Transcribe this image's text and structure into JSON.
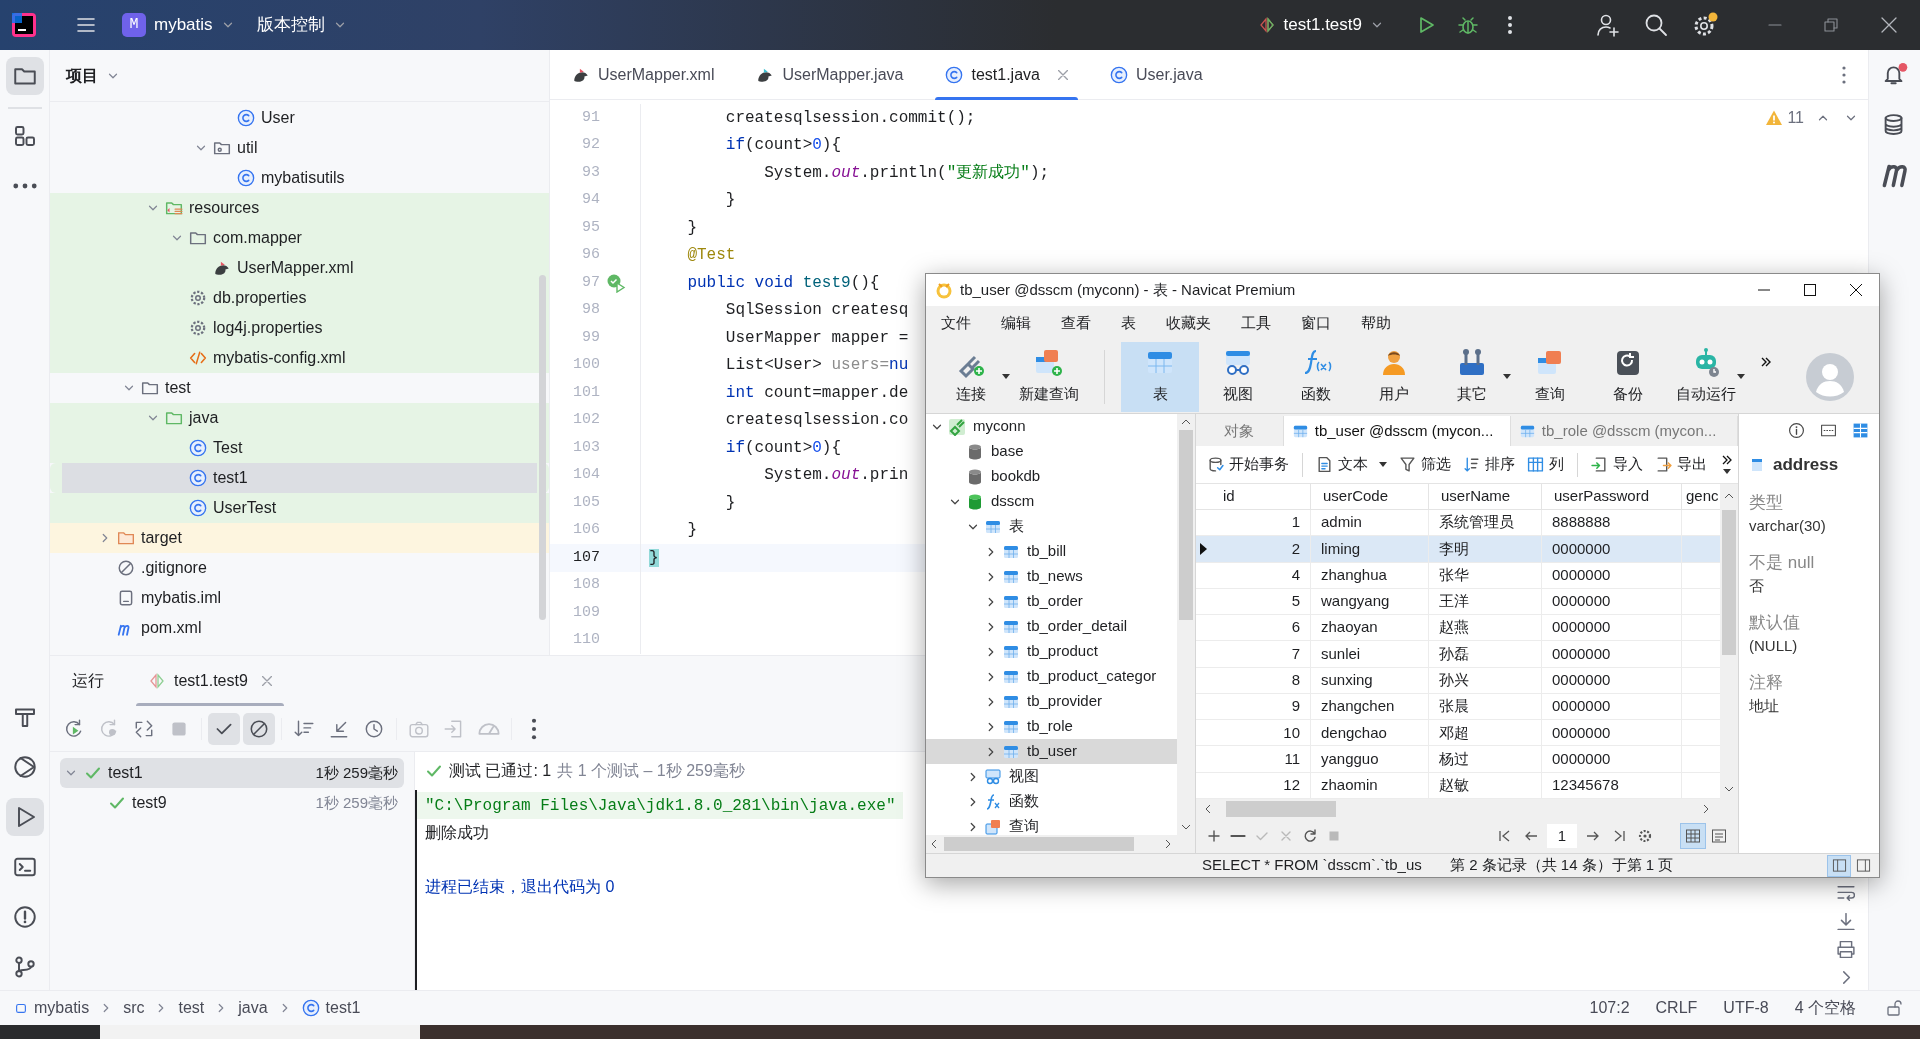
{
  "titlebar": {
    "project_badge": "M",
    "project": "mybatis",
    "vcs": "版本控制",
    "run_config": "test1.test9",
    "settings_badge": true
  },
  "left_toolbar": {
    "top": [
      {
        "kind": "project",
        "selected": true
      },
      {
        "kind": "structure",
        "selected": false
      },
      {
        "kind": "more",
        "selected": false
      }
    ],
    "bottom": [
      {
        "kind": "build",
        "selected": false
      },
      {
        "kind": "services",
        "selected": false
      },
      {
        "kind": "run",
        "selected": true
      },
      {
        "kind": "terminal",
        "selected": false
      },
      {
        "kind": "problems",
        "selected": false
      },
      {
        "kind": "git",
        "selected": false
      }
    ]
  },
  "right_toolbar": [
    {
      "kind": "notifications",
      "badge": true
    },
    {
      "kind": "database",
      "badge": false
    },
    {
      "kind": "maven",
      "badge": false
    }
  ],
  "project_panel": {
    "title": "项目",
    "tree": [
      {
        "children": [
          {
            "children": [
              {
                "children": [
                  {
                    "children": [
                      {
                        "children": [
                          {
                            "label": "User",
                            "kind": "class",
                            "selected": false
                          }
                        ]
                      },
                      {
                        "label": "util",
                        "kind": "package",
                        "expanded": true,
                        "selected": false,
                        "children": [
                          {
                            "label": "mybatisutils",
                            "kind": "class",
                            "selected": false
                          }
                        ]
                      }
                    ]
                  }
                ]
              },
              {
                "label": "resources",
                "kind": "resources",
                "expanded": true,
                "selected": false,
                "color": "#e6f4e5",
                "children": [
                  {
                    "label": "com.mapper",
                    "kind": "folder",
                    "expanded": true,
                    "selected": false,
                    "color": "#e6f4e5",
                    "children": [
                      {
                        "label": "UserMapper.xml",
                        "kind": "bird",
                        "selected": false,
                        "color": "#e6f4e5"
                      }
                    ]
                  },
                  {
                    "label": "db.properties",
                    "kind": "gear",
                    "selected": false,
                    "color": "#e6f4e5"
                  },
                  {
                    "label": "log4j.properties",
                    "kind": "gear",
                    "selected": false,
                    "color": "#e6f4e5"
                  },
                  {
                    "label": "mybatis-config.xml",
                    "kind": "xml",
                    "selected": false,
                    "color": "#e6f4e5"
                  }
                ]
              }
            ]
          },
          {
            "label": "test",
            "kind": "folder",
            "expanded": true,
            "selected": false,
            "children": [
              {
                "label": "java",
                "kind": "test_folder",
                "expanded": true,
                "selected": false,
                "color": "#e6f4e5",
                "children": [
                  {
                    "label": "Test",
                    "kind": "class",
                    "selected": false,
                    "color": "#e6f4e5"
                  },
                  {
                    "label": "test1",
                    "kind": "class",
                    "selected": true,
                    "color": "#e6f4e5"
                  },
                  {
                    "label": "UserTest",
                    "kind": "class",
                    "selected": false,
                    "color": "#e6f4e5"
                  }
                ]
              }
            ]
          }
        ]
      },
      {
        "label": "target",
        "kind": "excluded_folder",
        "expanded": false,
        "selected": false,
        "color": "#fdf5df"
      },
      {
        "label": ".gitignore",
        "kind": "ignore",
        "selected": false
      },
      {
        "label": "mybatis.iml",
        "kind": "module_file",
        "selected": false
      },
      {
        "label": "pom.xml",
        "kind": "maven",
        "selected": false
      }
    ]
  },
  "editor": {
    "tabs": [
      {
        "label": "UserMapper.xml",
        "kind": "bird",
        "selected": false,
        "closable": false
      },
      {
        "label": "UserMapper.java",
        "kind": "bird_java",
        "selected": false,
        "closable": false
      },
      {
        "label": "test1.java",
        "kind": "class",
        "selected": true,
        "closable": true
      },
      {
        "label": "User.java",
        "kind": "class",
        "selected": false,
        "closable": false
      }
    ],
    "warnings": "11",
    "lines": [
      {
        "number": "91",
        "kind": "code",
        "segments": [
          {
            "kind": "plain",
            "text": "        createsqlsession.commit();"
          }
        ]
      },
      {
        "number": "92",
        "kind": "code",
        "segments": [
          {
            "kind": "keyword",
            "text": "        if"
          },
          {
            "kind": "plain",
            "text": "(count>"
          },
          {
            "kind": "number",
            "text": "0"
          },
          {
            "kind": "plain",
            "text": "){"
          }
        ]
      },
      {
        "number": "93",
        "kind": "code",
        "segments": [
          {
            "kind": "plain",
            "text": "            System."
          },
          {
            "kind": "field",
            "text": "out"
          },
          {
            "kind": "plain",
            "text": ".println("
          },
          {
            "kind": "string",
            "text": "\"更新成功\""
          },
          {
            "kind": "plain",
            "text": ");"
          }
        ]
      },
      {
        "number": "94",
        "kind": "code",
        "segments": [
          {
            "kind": "plain",
            "text": "        }"
          }
        ]
      },
      {
        "number": "95",
        "kind": "code",
        "segments": [
          {
            "kind": "plain",
            "text": "    }"
          }
        ]
      },
      {
        "number": "96",
        "kind": "code",
        "segments": [
          {
            "kind": "annotation",
            "text": "    @Test"
          }
        ]
      },
      {
        "number": "97",
        "kind": "test_method",
        "segments": [
          {
            "kind": "keyword",
            "text": "    public"
          },
          {
            "kind": "keyword",
            "text": " void"
          },
          {
            "kind": "method",
            "text": " test9"
          },
          {
            "kind": "plain",
            "text": "(){"
          }
        ]
      },
      {
        "number": "98",
        "kind": "code",
        "segments": [
          {
            "kind": "plain",
            "text": "        SqlSession createsq"
          }
        ]
      },
      {
        "number": "99",
        "kind": "code",
        "segments": [
          {
            "kind": "plain",
            "text": "        UserMapper mapper ="
          }
        ]
      },
      {
        "number": "100",
        "kind": "code",
        "segments": [
          {
            "kind": "plain",
            "text": "        List<User> "
          },
          {
            "kind": "unused",
            "text": "users="
          },
          {
            "kind": "keyword",
            "text": "nu"
          }
        ]
      },
      {
        "number": "101",
        "kind": "code",
        "segments": [
          {
            "kind": "keyword",
            "text": "        int"
          },
          {
            "kind": "plain",
            "text": " count=mapper.de"
          }
        ]
      },
      {
        "number": "102",
        "kind": "code",
        "segments": [
          {
            "kind": "plain",
            "text": "        createsqlsession.co"
          }
        ]
      },
      {
        "number": "103",
        "kind": "code",
        "segments": [
          {
            "kind": "keyword",
            "text": "        if"
          },
          {
            "kind": "plain",
            "text": "(count>"
          },
          {
            "kind": "number",
            "text": "0"
          },
          {
            "kind": "plain",
            "text": "){"
          }
        ]
      },
      {
        "number": "104",
        "kind": "code",
        "segments": [
          {
            "kind": "plain",
            "text": "            System."
          },
          {
            "kind": "field",
            "text": "out"
          },
          {
            "kind": "plain",
            "text": ".prin"
          }
        ]
      },
      {
        "number": "105",
        "kind": "code",
        "segments": [
          {
            "kind": "plain",
            "text": "        }"
          }
        ]
      },
      {
        "number": "106",
        "kind": "code",
        "segments": [
          {
            "kind": "plain",
            "text": "    }"
          }
        ]
      },
      {
        "number": "107",
        "kind": "current",
        "segments": [
          {
            "kind": "brace",
            "text": "}"
          }
        ]
      },
      {
        "number": "108",
        "kind": "empty"
      },
      {
        "number": "109",
        "kind": "empty"
      },
      {
        "number": "110",
        "kind": "empty"
      }
    ]
  },
  "run_panel": {
    "tabs": [
      {
        "label": "运行",
        "selected": false,
        "closable": false
      },
      {
        "label": "test1.test9",
        "selected": true,
        "closable": true
      }
    ],
    "toolbar": [
      {
        "kind": "rerun",
        "disabled": false,
        "selected": false
      },
      {
        "kind": "rerun_failed",
        "disabled": true,
        "selected": false
      },
      {
        "kind": "toggle_auto",
        "disabled": false,
        "selected": false
      },
      {
        "kind": "stop",
        "disabled": true,
        "selected": false
      },
      {
        "kind": "show_passed",
        "disabled": false,
        "selected": true
      },
      {
        "kind": "show_ignored",
        "disabled": false,
        "selected": true
      },
      {
        "kind": "sort",
        "disabled": false,
        "selected": false
      },
      {
        "kind": "collapse",
        "disabled": false,
        "selected": false
      },
      {
        "kind": "history",
        "disabled": false,
        "selected": false
      },
      {
        "kind": "screenshot",
        "disabled": true,
        "selected": false
      },
      {
        "kind": "import",
        "disabled": true,
        "selected": false
      },
      {
        "kind": "coverage",
        "disabled": true,
        "selected": false
      },
      {
        "kind": "more",
        "disabled": false,
        "selected": false
      }
    ],
    "tests": [
      {
        "name": "test1",
        "time": "1秒 259毫秒",
        "passed": true,
        "expanded": true,
        "selected": true,
        "children": [
          {
            "name": "test9",
            "time": "1秒 259毫秒",
            "passed": true,
            "selected": false
          }
        ]
      }
    ],
    "summary": {
      "status": "测试 已通过: 1",
      "detail": "共 1 个测试 – 1秒 259毫秒"
    },
    "console": [
      {
        "kind": "command",
        "text": "\"C:\\Program Files\\Java\\jdk1.8.0_281\\bin\\java.exe\""
      },
      {
        "kind": "output",
        "text": "删除成功"
      },
      {
        "kind": "system",
        "text": "进程已结束，退出代码为 0"
      }
    ],
    "side_tools": [
      {
        "kind": "soft_wrap"
      },
      {
        "kind": "scroll_end"
      },
      {
        "kind": "print"
      },
      {
        "kind": "collapse"
      }
    ]
  },
  "status_bar": {
    "breadcrumbs": [
      {
        "label": "mybatis",
        "kind": "module"
      },
      {
        "label": "src",
        "kind": "plain"
      },
      {
        "label": "test",
        "kind": "plain"
      },
      {
        "label": "java",
        "kind": "plain"
      },
      {
        "label": "test1",
        "kind": "class"
      }
    ],
    "info": [
      "107:2",
      "CRLF",
      "UTF-8",
      "4 个空格"
    ]
  },
  "navicat": {
    "title": "tb_user @dsscm (myconn) - 表 - Navicat Premium",
    "menu": [
      "文件",
      "编辑",
      "查看",
      "表",
      "收藏夹",
      "工具",
      "窗口",
      "帮助"
    ],
    "toolbar": [
      {
        "label": "连接",
        "kind": "connect",
        "dropdown": true,
        "selected": false
      },
      {
        "label": "新建查询",
        "kind": "new_query",
        "dropdown": false,
        "selected": false
      },
      {
        "label": "表",
        "kind": "table",
        "dropdown": false,
        "selected": true
      },
      {
        "label": "视图",
        "kind": "view",
        "dropdown": false,
        "selected": false
      },
      {
        "label": "函数",
        "kind": "function",
        "dropdown": false,
        "selected": false
      },
      {
        "label": "用户",
        "kind": "user",
        "dropdown": false,
        "selected": false
      },
      {
        "label": "其它",
        "kind": "tools",
        "dropdown": true,
        "selected": false
      },
      {
        "label": "查询",
        "kind": "query",
        "dropdown": false,
        "selected": false
      },
      {
        "label": "备份",
        "kind": "backup",
        "dropdown": false,
        "selected": false
      },
      {
        "label": "自动运行",
        "kind": "robot",
        "dropdown": true,
        "selected": false
      }
    ],
    "tree": [
      {
        "label": "myconn",
        "kind": "connection",
        "expanded": true,
        "selected": false,
        "children": [
          {
            "label": "base",
            "kind": "database",
            "selected": false
          },
          {
            "label": "bookdb",
            "kind": "database",
            "selected": false
          },
          {
            "label": "dsscm",
            "kind": "database_open",
            "expanded": true,
            "selected": false,
            "children": [
              {
                "label": "表",
                "kind": "tables",
                "expanded": true,
                "selected": false,
                "children": [
                  {
                    "label": "tb_bill",
                    "kind": "table",
                    "expanded": false,
                    "selected": false
                  },
                  {
                    "label": "tb_news",
                    "kind": "table",
                    "expanded": false,
                    "selected": false
                  },
                  {
                    "label": "tb_order",
                    "kind": "table",
                    "expanded": false,
                    "selected": false
                  },
                  {
                    "label": "tb_order_detail",
                    "kind": "table",
                    "expanded": false,
                    "selected": false
                  },
                  {
                    "label": "tb_product",
                    "kind": "table",
                    "expanded": false,
                    "selected": false
                  },
                  {
                    "label": "tb_product_categor",
                    "kind": "table",
                    "expanded": false,
                    "selected": false
                  },
                  {
                    "label": "tb_provider",
                    "kind": "table",
                    "expanded": false,
                    "selected": false
                  },
                  {
                    "label": "tb_role",
                    "kind": "table",
                    "expanded": false,
                    "selected": false
                  },
                  {
                    "label": "tb_user",
                    "kind": "table",
                    "expanded": false,
                    "selected": true
                  }
                ]
              },
              {
                "label": "视图",
                "kind": "views",
                "expanded": false,
                "selected": false
              },
              {
                "label": "函数",
                "kind": "functions",
                "expanded": false,
                "selected": false
              },
              {
                "label": "查询",
                "kind": "queries",
                "expanded": false,
                "selected": false
              }
            ]
          }
        ]
      }
    ],
    "tabs": [
      {
        "label": "对象",
        "kind": "plain",
        "selected": false
      },
      {
        "label": "tb_user @dsscm (mycon...",
        "kind": "table",
        "selected": true
      },
      {
        "label": "tb_role @dsscm (mycon...",
        "kind": "table",
        "selected": false
      }
    ],
    "grid_toolbar": [
      {
        "label": "开始事务",
        "kind": "transaction",
        "dropdown": false
      },
      {
        "label": "文本",
        "kind": "text",
        "dropdown": true
      },
      {
        "label": "筛选",
        "kind": "filter",
        "dropdown": false
      },
      {
        "label": "排序",
        "kind": "sort",
        "dropdown": false
      },
      {
        "label": "列",
        "kind": "columns",
        "dropdown": false
      },
      {
        "label": "导入",
        "kind": "import",
        "dropdown": false
      },
      {
        "label": "导出",
        "kind": "export",
        "dropdown": false
      }
    ],
    "columns": [
      "id",
      "userCode",
      "userName",
      "userPassword",
      "genc"
    ],
    "rows": [
      {
        "cells": [
          "1",
          "admin",
          "系统管理员",
          "8888888"
        ],
        "selected": false
      },
      {
        "cells": [
          "2",
          "liming",
          "李明",
          "0000000"
        ],
        "selected": true
      },
      {
        "cells": [
          "4",
          "zhanghua",
          "张华",
          "0000000"
        ],
        "selected": false
      },
      {
        "cells": [
          "5",
          "wangyang",
          "王洋",
          "0000000"
        ],
        "selected": false
      },
      {
        "cells": [
          "6",
          "zhaoyan",
          "赵燕",
          "0000000"
        ],
        "selected": false
      },
      {
        "cells": [
          "7",
          "sunlei",
          "孙磊",
          "0000000"
        ],
        "selected": false
      },
      {
        "cells": [
          "8",
          "sunxing",
          "孙兴",
          "0000000"
        ],
        "selected": false
      },
      {
        "cells": [
          "9",
          "zhangchen",
          "张晨",
          "0000000"
        ],
        "selected": false
      },
      {
        "cells": [
          "10",
          "dengchao",
          "邓超",
          "0000000"
        ],
        "selected": false
      },
      {
        "cells": [
          "11",
          "yangguo",
          "杨过",
          "0000000"
        ],
        "selected": false
      },
      {
        "cells": [
          "12",
          "zhaomin",
          "赵敏",
          "12345678"
        ],
        "selected": false
      }
    ],
    "nav_tools": [
      {
        "kind": "add",
        "disabled": false
      },
      {
        "kind": "delete",
        "disabled": false
      },
      {
        "kind": "apply",
        "disabled": true
      },
      {
        "kind": "discard",
        "disabled": true
      },
      {
        "kind": "refresh",
        "disabled": false
      },
      {
        "kind": "stop",
        "disabled": true
      }
    ],
    "page": "1",
    "views": [
      {
        "kind": "grid",
        "selected": true
      },
      {
        "kind": "form",
        "selected": false
      }
    ],
    "sql": "SELECT * FROM `dsscm`.`tb_us",
    "record_info": "第 2 条记录（共 14 条）于第 1 页",
    "panes": [
      {
        "kind": "left",
        "selected": true
      },
      {
        "kind": "right",
        "selected": false
      }
    ],
    "info_tabs": [
      {
        "kind": "info",
        "selected": false
      },
      {
        "kind": "ddl",
        "selected": false
      },
      {
        "kind": "fields",
        "selected": true
      }
    ],
    "field": {
      "name": "address",
      "properties": [
        {
          "label": "类型",
          "value": "varchar(30)"
        },
        {
          "label": "不是 null",
          "value": "否"
        },
        {
          "label": "默认值",
          "value": "(NULL)"
        },
        {
          "label": "注释",
          "value": "地址"
        }
      ]
    }
  }
}
